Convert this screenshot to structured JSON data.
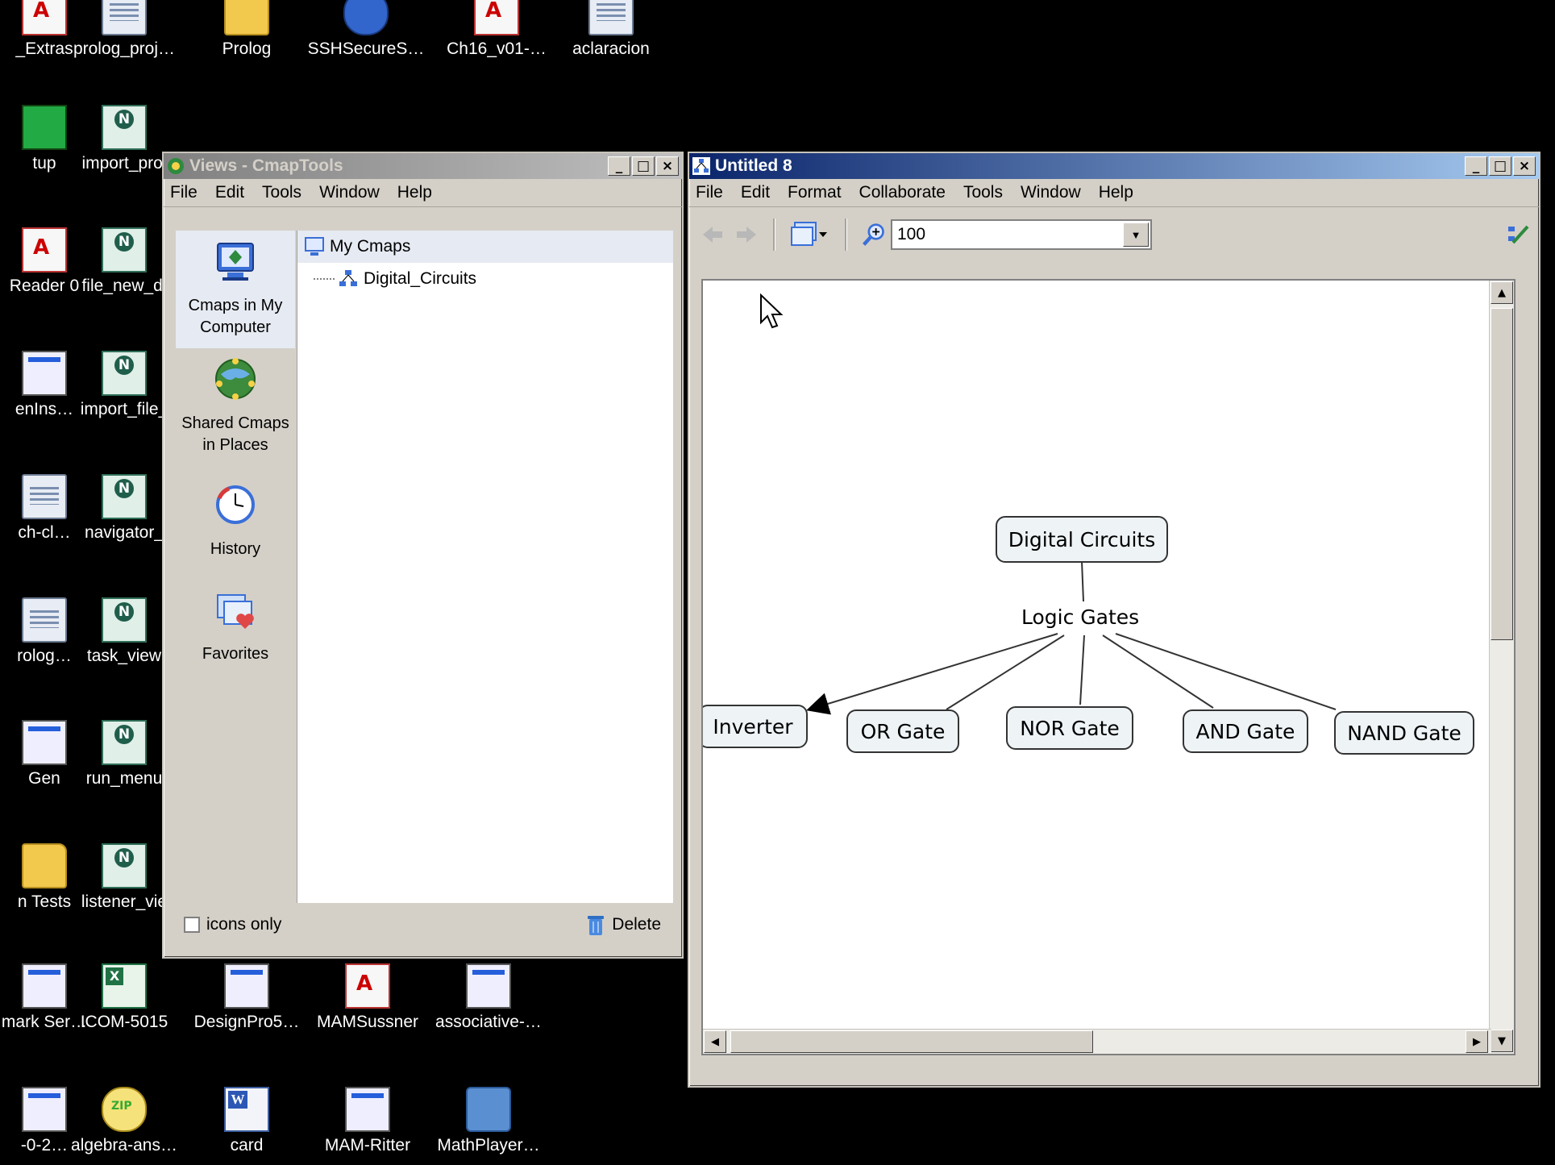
{
  "desktop": {
    "icons": [
      {
        "label": "_Extras",
        "kind": "pdf"
      },
      {
        "label": "prolog_proj…",
        "kind": "doc"
      },
      {
        "label": "Prolog",
        "kind": "folder"
      },
      {
        "label": "SSHSecureS…",
        "kind": "globe"
      },
      {
        "label": "Ch16_v01-…",
        "kind": "pdf"
      },
      {
        "label": "aclaracion",
        "kind": "doc"
      },
      {
        "label": "tup",
        "kind": "setup"
      },
      {
        "label": "import_proj",
        "kind": "net"
      },
      {
        "label": "Reader 0",
        "kind": "pdf"
      },
      {
        "label": "file_new_di",
        "kind": "net"
      },
      {
        "label": "enIns…",
        "kind": "app"
      },
      {
        "label": "import_file_",
        "kind": "net"
      },
      {
        "label": "ch-cl…",
        "kind": "doc"
      },
      {
        "label": "navigator_",
        "kind": "net"
      },
      {
        "label": "rolog…",
        "kind": "doc"
      },
      {
        "label": "task_view",
        "kind": "net"
      },
      {
        "label": "Gen",
        "kind": "app"
      },
      {
        "label": "run_menu",
        "kind": "net"
      },
      {
        "label": "n Tests",
        "kind": "folder"
      },
      {
        "label": "listener_vie",
        "kind": "net"
      },
      {
        "label": "mark Ser…",
        "kind": "app"
      },
      {
        "label": "ICOM-5015",
        "kind": "excel"
      },
      {
        "label": "DesignPro5…",
        "kind": "app"
      },
      {
        "label": "MAMSussner",
        "kind": "pdf"
      },
      {
        "label": "associative-…",
        "kind": "app"
      },
      {
        "label": "-0-2…",
        "kind": "app"
      },
      {
        "label": "algebra-ans…",
        "kind": "zip"
      },
      {
        "label": "card",
        "kind": "word"
      },
      {
        "label": "MAM-Ritter",
        "kind": "app"
      },
      {
        "label": "MathPlayer…",
        "kind": "math"
      }
    ]
  },
  "views_window": {
    "title": "Views - CmapTools",
    "menu": [
      "File",
      "Edit",
      "Tools",
      "Window",
      "Help"
    ],
    "nav": [
      {
        "label": "Cmaps in My Computer",
        "icon": "computer-icon",
        "selected": true
      },
      {
        "label": "Shared Cmaps in Places",
        "icon": "globe-icon",
        "selected": false
      },
      {
        "label": "History",
        "icon": "clock-icon",
        "selected": false
      },
      {
        "label": "Favorites",
        "icon": "favorites-icon",
        "selected": false
      }
    ],
    "tree": {
      "root": "My Cmaps",
      "children": [
        "Digital_Circuits"
      ]
    },
    "icons_only_label": "icons only",
    "icons_only_checked": false,
    "delete_label": "Delete"
  },
  "map_window": {
    "title": "Untitled 8",
    "menu": [
      "File",
      "Edit",
      "Format",
      "Collaborate",
      "Tools",
      "Window",
      "Help"
    ],
    "zoom": "100",
    "concept_map": {
      "root": "Digital Circuits",
      "linking_phrase": "Logic Gates",
      "concepts": [
        "Inverter",
        "OR Gate",
        "NOR Gate",
        "AND Gate",
        "NAND Gate"
      ]
    }
  }
}
